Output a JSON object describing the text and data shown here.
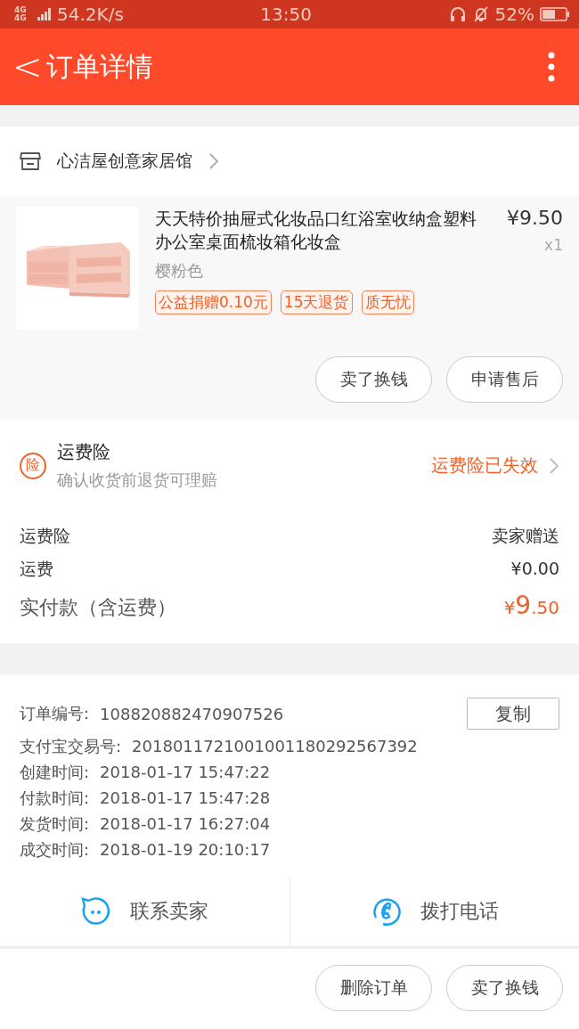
{
  "status_bar": {
    "network": "4G 4G",
    "speed": "54.2K/s",
    "time": "13:50",
    "battery": "52%"
  },
  "header": {
    "back": "<",
    "title": "订单详情"
  },
  "shop": {
    "name": "心洁屋创意家居馆"
  },
  "product": {
    "title": "天天特价抽屉式化妆品口红浴室收纳盒塑料办公室桌面梳妆箱化妆盒",
    "price": "¥9.50",
    "quantity": "x1",
    "variant": "樱粉色",
    "tags": [
      "公益捐赠0.10元",
      "15天退货",
      "质无忧"
    ],
    "buttons": [
      "卖了换钱",
      "申请售后"
    ]
  },
  "insurance": {
    "badge": "险",
    "title": "运费险",
    "subtitle": "确认收货前退货可理赔",
    "status": "运费险已失效"
  },
  "fees": [
    {
      "label": "运费险",
      "value": "卖家赠送",
      "kind": "plain"
    },
    {
      "label": "运费",
      "value": "¥0.00",
      "kind": "plain"
    },
    {
      "label": "实付款（含运费）",
      "value": "¥9.50",
      "kind": "total"
    }
  ],
  "order_info": {
    "copy_button": "复制",
    "rows": [
      {
        "label": "订单编号:",
        "value": "108820882470907526"
      },
      {
        "label": "支付宝交易号:",
        "value": "2018011721001001180292567392"
      },
      {
        "label": "创建时间:",
        "value": "2018-01-17 15:47:22"
      },
      {
        "label": "付款时间:",
        "value": "2018-01-17 15:47:28"
      },
      {
        "label": "发货时间:",
        "value": "2018-01-17 16:27:04"
      },
      {
        "label": "成交时间:",
        "value": "2018-01-19 20:10:17"
      }
    ]
  },
  "contact": [
    {
      "label": "联系卖家",
      "kind": "chat"
    },
    {
      "label": "拨打电话",
      "kind": "phone"
    }
  ],
  "footer_buttons": [
    "删除订单",
    "卖了换钱"
  ]
}
